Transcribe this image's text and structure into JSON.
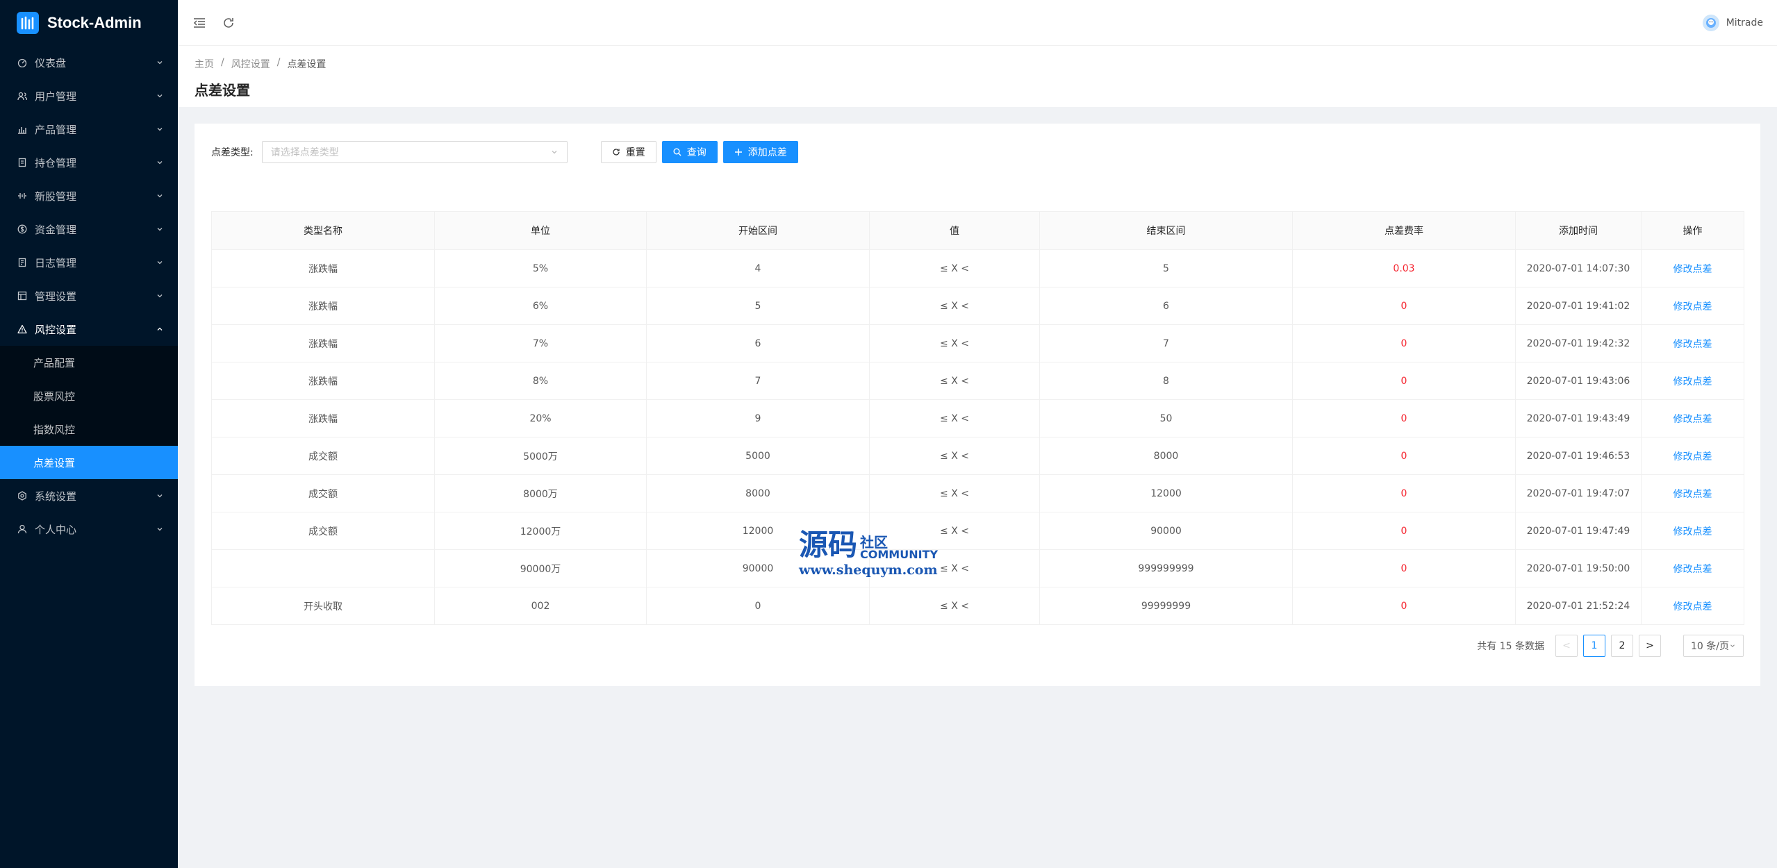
{
  "app": {
    "title": "Stock-Admin"
  },
  "sidebar": {
    "items": [
      {
        "label": "仪表盘",
        "icon": "dashboard-icon"
      },
      {
        "label": "用户管理",
        "icon": "users-icon"
      },
      {
        "label": "产品管理",
        "icon": "bar-chart-icon"
      },
      {
        "label": "持仓管理",
        "icon": "position-icon"
      },
      {
        "label": "新股管理",
        "icon": "newstock-icon"
      },
      {
        "label": "资金管理",
        "icon": "money-icon"
      },
      {
        "label": "日志管理",
        "icon": "log-icon"
      },
      {
        "label": "管理设置",
        "icon": "admin-settings-icon"
      },
      {
        "label": "风控设置",
        "icon": "warning-icon"
      },
      {
        "label": "系统设置",
        "icon": "system-settings-icon"
      },
      {
        "label": "个人中心",
        "icon": "user-icon"
      }
    ],
    "risk_submenu": [
      "产品配置",
      "股票风控",
      "指数风控",
      "点差设置"
    ]
  },
  "header": {
    "username": "Mitrade"
  },
  "breadcrumb": [
    "主页",
    "/",
    "风控设置",
    "/",
    "点差设置"
  ],
  "page_title": "点差设置",
  "filter": {
    "label": "点差类型:",
    "placeholder": "请选择点差类型",
    "reset": "重置",
    "query": "查询",
    "add": "添加点差"
  },
  "table": {
    "headers": [
      "类型名称",
      "单位",
      "开始区间",
      "值",
      "结束区间",
      "点差费率",
      "添加时间",
      "操作"
    ],
    "rows": [
      [
        "涨跌幅",
        "5%",
        "4",
        "≤ X <",
        "5",
        "0.03",
        "2020-07-01 14:07:30",
        "修改点差"
      ],
      [
        "涨跌幅",
        "6%",
        "5",
        "≤ X <",
        "6",
        "0",
        "2020-07-01 19:41:02",
        "修改点差"
      ],
      [
        "涨跌幅",
        "7%",
        "6",
        "≤ X <",
        "7",
        "0",
        "2020-07-01 19:42:32",
        "修改点差"
      ],
      [
        "涨跌幅",
        "8%",
        "7",
        "≤ X <",
        "8",
        "0",
        "2020-07-01 19:43:06",
        "修改点差"
      ],
      [
        "涨跌幅",
        "20%",
        "9",
        "≤ X <",
        "50",
        "0",
        "2020-07-01 19:43:49",
        "修改点差"
      ],
      [
        "成交额",
        "5000万",
        "5000",
        "≤ X <",
        "8000",
        "0",
        "2020-07-01 19:46:53",
        "修改点差"
      ],
      [
        "成交额",
        "8000万",
        "8000",
        "≤ X <",
        "12000",
        "0",
        "2020-07-01 19:47:07",
        "修改点差"
      ],
      [
        "成交额",
        "12000万",
        "12000",
        "≤ X <",
        "90000",
        "0",
        "2020-07-01 19:47:49",
        "修改点差"
      ],
      [
        "",
        "90000万",
        "90000",
        "≤ X <",
        "999999999",
        "0",
        "2020-07-01 19:50:00",
        "修改点差"
      ],
      [
        "开头收取",
        "002",
        "0",
        "≤ X <",
        "99999999",
        "0",
        "2020-07-01 21:52:24",
        "修改点差"
      ]
    ]
  },
  "pagination": {
    "total_text": "共有 15 条数据",
    "prev": "<",
    "pages": [
      "1",
      "2"
    ],
    "current": "1",
    "next": ">",
    "page_size": "10 条/页"
  },
  "watermark": {
    "big": "源码",
    "she": "社区",
    "community": "COMMUNITY",
    "url": "www.shequym.com"
  },
  "colors": {
    "sidebar_bg": "#001529",
    "primary": "#1890ff",
    "danger": "#f5222d"
  }
}
